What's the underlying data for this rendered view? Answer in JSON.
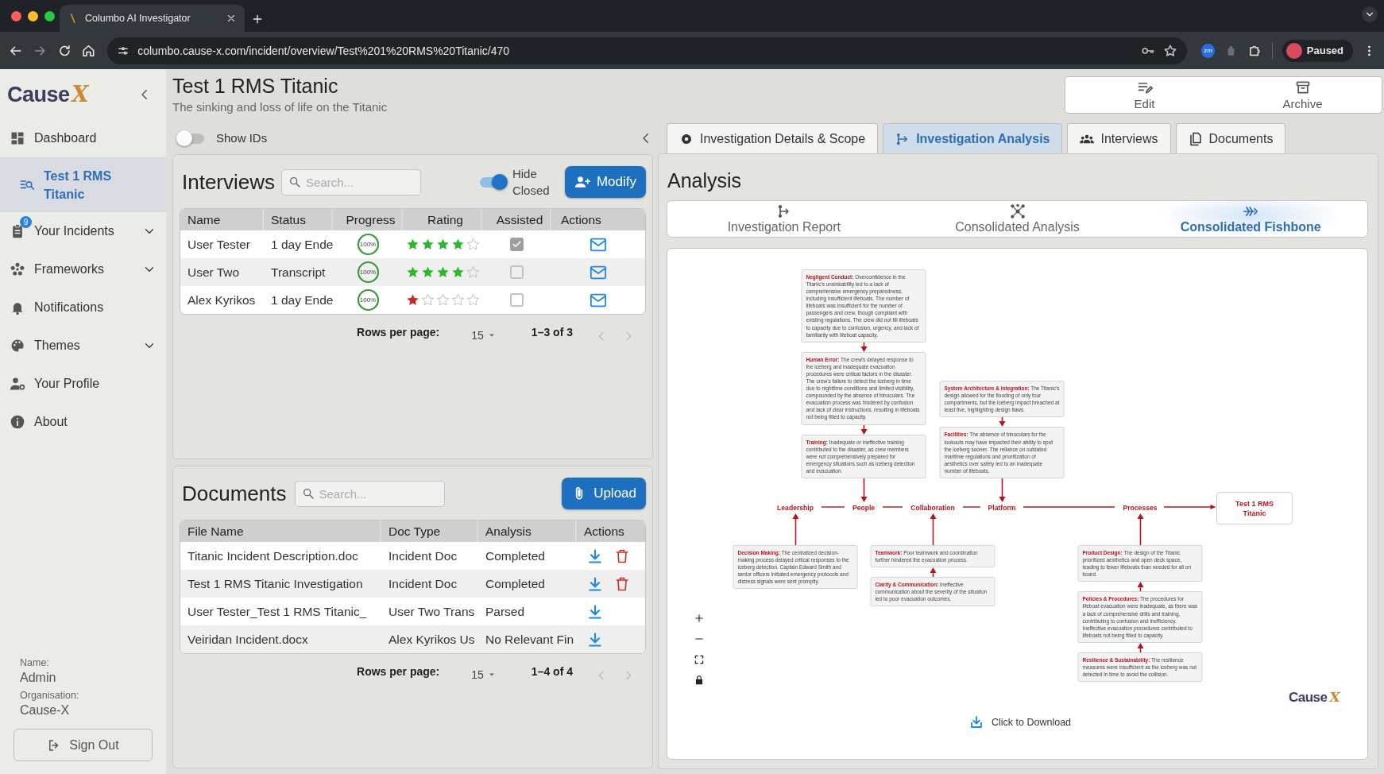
{
  "browser": {
    "tab_title": "Columbo AI Investigator",
    "url": "columbo.cause-x.com/incident/overview/Test%201%20RMS%20Titanic/470",
    "extension_label": "zm",
    "profile_label": "Paused"
  },
  "sidebar": {
    "logo_word": "Cause",
    "logo_mark": "X",
    "items": [
      {
        "label": "Dashboard",
        "kind": "dashboard",
        "selected": false,
        "expandable": false
      },
      {
        "label": "Test 1 RMS Titanic",
        "kind": "incident",
        "selected": true,
        "expandable": false
      },
      {
        "label": "Your Incidents",
        "kind": "clipboard",
        "selected": false,
        "expandable": true,
        "badge": "9"
      },
      {
        "label": "Frameworks",
        "kind": "frameworks",
        "selected": false,
        "expandable": true
      },
      {
        "label": "Notifications",
        "kind": "bell",
        "selected": false,
        "expandable": false
      },
      {
        "label": "Themes",
        "kind": "palette",
        "selected": false,
        "expandable": true
      },
      {
        "label": "Your Profile",
        "kind": "profile",
        "selected": false,
        "expandable": false
      },
      {
        "label": "About",
        "kind": "info",
        "selected": false,
        "expandable": false
      }
    ],
    "name_label": "Name:",
    "name": "Admin",
    "org_label": "Organisation:",
    "org": "Cause-X",
    "sign_out": "Sign Out"
  },
  "header": {
    "title": "Test 1 RMS Titanic",
    "subtitle": "The sinking and loss of life on the Titanic",
    "actions": [
      {
        "label": "Edit",
        "kind": "edit"
      },
      {
        "label": "Archive",
        "kind": "archive"
      }
    ]
  },
  "show_ids": {
    "label": "Show IDs",
    "on": false
  },
  "interviews": {
    "title": "Interviews",
    "search_placeholder": "Search...",
    "hide_closed": {
      "label": "Hide Closed",
      "on": true
    },
    "modify": "Modify",
    "columns": [
      "Name",
      "Status",
      "Progress",
      "Rating",
      "Assisted",
      "Actions"
    ],
    "rows": [
      {
        "name": "User Tester",
        "status": "1 day Ende",
        "progress": "100%",
        "stars": 4,
        "assisted": true
      },
      {
        "name": "User Two",
        "status": "Transcript",
        "progress": "100%",
        "stars": 4,
        "assisted": false
      },
      {
        "name": "Alex Kyrikos",
        "status": "1 day Ende",
        "progress": "100%",
        "stars": 1,
        "assisted": false
      }
    ],
    "rows_label": "Rows per page:",
    "rows_value": "15",
    "range": "1–3 of 3"
  },
  "documents": {
    "title": "Documents",
    "search_placeholder": "Search...",
    "upload": "Upload",
    "columns": [
      "File Name",
      "Doc Type",
      "Analysis",
      "Actions"
    ],
    "rows": [
      {
        "file": "Titanic Incident Description.doc",
        "doc_type": "Incident Doc",
        "analysis": "Completed",
        "deletable": true
      },
      {
        "file": "Test 1 RMS Titanic Investigation",
        "doc_type": "Incident Doc",
        "analysis": "Completed",
        "deletable": true
      },
      {
        "file": "User Tester_Test 1 RMS Titanic_",
        "doc_type": "User Two Trans",
        "analysis": "Parsed",
        "deletable": false
      },
      {
        "file": "Veiridan Incident.docx",
        "doc_type": "Alex Kyrikos Us",
        "analysis": "No Relevant Fin",
        "deletable": false
      }
    ],
    "rows_label": "Rows per page:",
    "rows_value": "15",
    "range": "1–4 of 4"
  },
  "tabs": [
    {
      "label": "Investigation Details & Scope",
      "kind": "details",
      "selected": false
    },
    {
      "label": "Investigation Analysis",
      "kind": "analysis",
      "selected": true
    },
    {
      "label": "Interviews",
      "kind": "interviews",
      "selected": false
    },
    {
      "label": "Documents",
      "kind": "documents",
      "selected": false
    }
  ],
  "analysis": {
    "title": "Analysis",
    "views": [
      {
        "label": "Investigation Report",
        "kind": "report",
        "selected": false
      },
      {
        "label": "Consolidated Analysis",
        "kind": "network",
        "selected": false
      },
      {
        "label": "Consolidated Fishbone",
        "kind": "fishbone",
        "selected": true
      }
    ],
    "fishbone": {
      "effect": "Test 1 RMS Titanic",
      "categories": [
        {
          "label": "Leadership",
          "kind": "lower",
          "causes": [
            "**Decision Making:** The centralized decision-making process delayed critical responses to the iceberg detection. Captain Edward Smith and senior officers initiated emergency protocols and distress signals were sent promptly."
          ]
        },
        {
          "label": "People",
          "kind": "upper",
          "causes": [
            "**Negligent Conduct:** Overconfidence in the Titanic's unsinkability led to a lack of comprehensive emergency preparedness, including insufficient lifeboats. The number of lifeboats was insufficient for the number of passengers and crew, though compliant with existing regulations. The crew did not fill lifeboats to capacity due to confusion, urgency, and lack of familiarity with lifeboat capacity.",
            "**Human Error:** The crew's delayed response to the iceberg and inadequate evacuation procedures were critical factors in the disaster. The crew's failure to detect the iceberg in time due to nighttime conditions and limited visibility, compounded by the absence of binoculars. The evacuation process was hindered by confusion and lack of clear instructions, resulting in lifeboats not being filled to capacity.",
            "**Training:** Inadequate or ineffective training contributed to the disaster, as crew members were not comprehensively prepared for emergency situations such as iceberg detection and evacuation."
          ]
        },
        {
          "label": "Collaboration",
          "kind": "lower",
          "causes": [
            "**Teamwork:** Poor teamwork and coordination further hindered the evacuation process.",
            "**Clarity & Communication:** Ineffective communication about the severity of the situation led to poor evacuation outcomes."
          ]
        },
        {
          "label": "Platform",
          "kind": "upper",
          "causes": [
            "**System Architecture & Integration:** The Titanic's design allowed for the flooding of only four compartments, but the iceberg impact breached at least five, highlighting design flaws.",
            "**Facilities:** The absence of binoculars for the lookouts may have impacted their ability to spot the iceberg sooner. The reliance on outdated maritime regulations and prioritization of aesthetics over safety led to an inadequate number of lifeboats."
          ]
        },
        {
          "label": "Processes",
          "kind": "lower",
          "causes": [
            "**Product Design:** The design of the Titanic prioritized aesthetics and open deck space, leading to fewer lifeboats than needed for all on board.",
            "**Policies & Procedures:** The procedures for lifeboat evacuation were inadequate, as there was a lack of comprehensive drills and training, contributing to confusion and inefficiency. Ineffective evacuation procedures contributed to lifeboats not being filled to capacity.",
            "**Resilience & Sustainability:** The resilience measures were insufficient as the iceberg was not detected in time to avoid the collision."
          ]
        }
      ]
    },
    "logo_word": "Cause",
    "logo_mark": "X",
    "download": "Click to Download"
  }
}
